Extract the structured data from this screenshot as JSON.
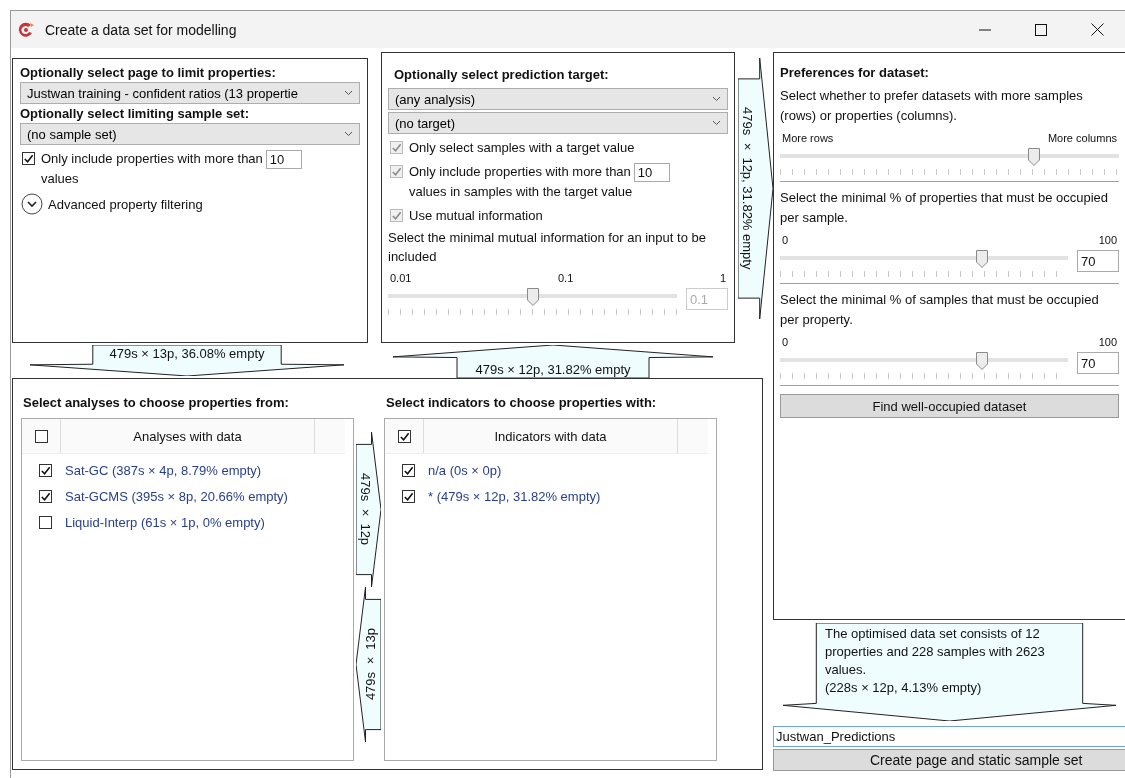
{
  "window": {
    "title": "Create a data set for modelling"
  },
  "page_filter": {
    "heading": "Optionally select page to limit properties:",
    "page_select": "Justwan training - confident ratios (13 propertie",
    "sample_set_heading": "Optionally select limiting sample set:",
    "sample_set_select": "(no sample set)",
    "min_values": {
      "label": "Only include properties with more than",
      "value": "10",
      "label_after": "values",
      "checked": true
    },
    "advanced": {
      "label": "Advanced property filtering",
      "expanded": false
    }
  },
  "page_filter_output": "479s × 13p, 36.08% empty",
  "target": {
    "heading": "Optionally select prediction target:",
    "analysis_select": "(any analysis)",
    "target_select": "(no target)",
    "options": [
      {
        "label": "Only select samples with a target value",
        "checked": true,
        "disabled": true
      },
      {
        "label": "Only include properties with more than",
        "value": "10",
        "label_after": "values in samples with the target value",
        "checked": true,
        "disabled": true
      },
      {
        "label": "Use mutual information",
        "checked": true,
        "disabled": true
      }
    ],
    "mi_label": "Select the minimal mutual information for an input to be included",
    "mi_slider": {
      "ticks": [
        "0.01",
        "0.1",
        "1"
      ],
      "level": 0.5,
      "value": "0.1",
      "disabled": true
    }
  },
  "target_output": "479s × 12p, 31.82% empty",
  "target_feedback": "479s × 12p, 31.82% empty",
  "preferences": {
    "heading": "Preferences for dataset:",
    "sections": [
      {
        "label": "Select whether to prefer datasets with more samples (rows) or properties (columns).",
        "ticks": [
          "More rows",
          "More columns"
        ],
        "level": 0.75
      },
      {
        "label": "Select the minimal % of properties that must be occupied per sample.",
        "ticks": [
          "0",
          "100"
        ],
        "level": 0.7,
        "value": "70"
      },
      {
        "label": "Select the minimal % of samples that must be occupied per property.",
        "ticks": [
          "0",
          "100"
        ],
        "level": 0.7,
        "value": "70"
      }
    ],
    "find_button": "Find well-occupied dataset"
  },
  "analyses": {
    "heading": "Select analyses to choose properties from:",
    "column": "Analyses with data",
    "all_checked": false,
    "rows": [
      {
        "label": "Sat-GC (387s × 4p, 8.79% empty)",
        "checked": true
      },
      {
        "label": "Sat-GCMS (395s × 8p, 20.66% empty)",
        "checked": true
      },
      {
        "label": "Liquid-Interp (61s × 1p, 0% empty)",
        "checked": false
      }
    ]
  },
  "analyses_output": "479s × 12p",
  "indicators_feedback": "479s × 13p",
  "indicators": {
    "heading": "Select indicators to choose properties with:",
    "column": "Indicators with data",
    "all_checked": true,
    "rows": [
      {
        "label": "n/a (0s × 0p)",
        "checked": true
      },
      {
        "label": "* (479s × 12p, 31.82% empty)",
        "checked": true
      }
    ]
  },
  "result": {
    "lines": [
      "The optimised data set consists of 12 properties and 228 samples with 2623 values.",
      "(228s × 12p, 4.13% empty)"
    ]
  },
  "name_field": {
    "value": "Justwan_Predictions"
  },
  "create_button": "Create page and static sample set"
}
